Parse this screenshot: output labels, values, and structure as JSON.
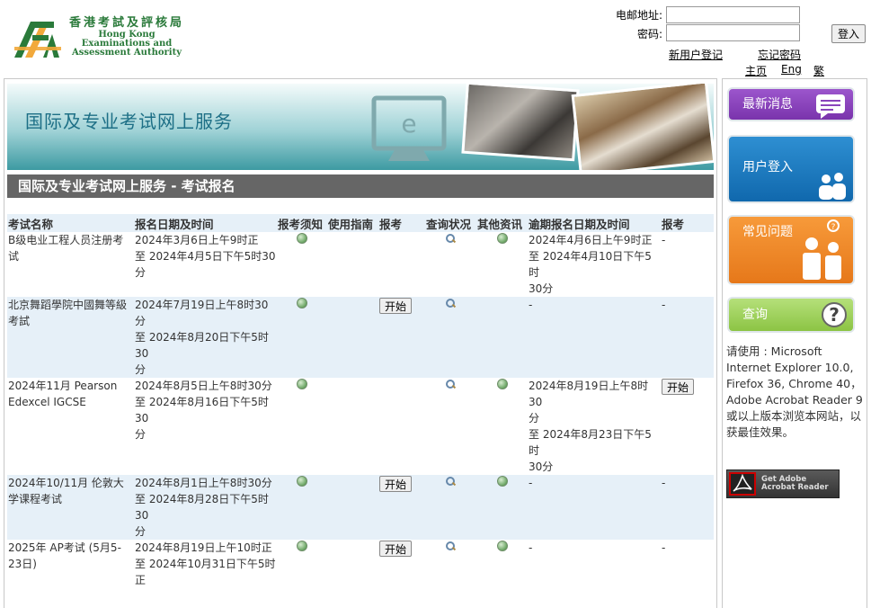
{
  "header": {
    "logo_cn": "香港考試及評核局",
    "logo_en_lines": [
      "Hong Kong",
      "Examinations and",
      "Assessment Authority"
    ],
    "logo_brand_colors": [
      "#2a7a3a",
      "#f2a93b"
    ]
  },
  "login": {
    "email_label": "电邮地址:",
    "password_label": "密码:",
    "email_value": "",
    "password_value": "",
    "login_button": "登入",
    "register_link": "新用户登记",
    "forgot_link": "忘记密码",
    "home_link": "主页",
    "eng_link": "Eng",
    "trad_link": "繁"
  },
  "banner": {
    "title": "国际及专业考试网上服务",
    "screen_letter": "e"
  },
  "section": {
    "title": "国际及专业考试网上服务 - 考试报名"
  },
  "table": {
    "headers": [
      "考试名称",
      "报名日期及时间",
      "报考须知",
      "使用指南",
      "报考",
      "查询状况",
      "其他资讯",
      "逾期报名日期及时间",
      "报考"
    ],
    "rows": [
      {
        "name": "B级电业工程人员注册考试",
        "period": [
          "2024年3月6日上午9时正",
          "至 2024年4月5日下午5时30",
          "分"
        ],
        "notes_icon": "info-icon",
        "guide": "",
        "apply": "",
        "status_icon": "search-icon",
        "other_icon": "info-icon",
        "late_period": [
          "2024年4月6日上午9时正",
          "至 2024年4月10日下午5时",
          "30分"
        ],
        "late_apply": "-"
      },
      {
        "name": "北京舞蹈學院中國舞等級考試",
        "period": [
          "2024年7月19日上午8时30分",
          "至 2024年8月20日下午5时30",
          "分"
        ],
        "notes_icon": "info-icon",
        "guide": "",
        "apply": "开始",
        "status_icon": "search-icon",
        "other_icon": "",
        "late_period": [
          "-"
        ],
        "late_apply": "-"
      },
      {
        "name": "2024年11月 Pearson Edexcel IGCSE",
        "period": [
          "2024年8月5日上午8时30分",
          "至 2024年8月16日下午5时30",
          "分"
        ],
        "notes_icon": "info-icon",
        "guide": "",
        "apply": "",
        "status_icon": "search-icon",
        "other_icon": "info-icon",
        "late_period": [
          "2024年8月19日上午8时30",
          "分",
          "至 2024年8月23日下午5时",
          "30分"
        ],
        "late_apply": "开始"
      },
      {
        "name": "2024年10/11月 伦敦大学课程考试",
        "period": [
          "2024年8月1日上午8时30分",
          "至 2024年8月28日下午5时30",
          "分"
        ],
        "notes_icon": "info-icon",
        "guide": "",
        "apply": "开始",
        "status_icon": "search-icon",
        "other_icon": "info-icon",
        "late_period": [
          "-"
        ],
        "late_apply": "-"
      },
      {
        "name": "2025年 AP考试 (5月5-23日)",
        "period": [
          "2024年8月19日上午10时正",
          "至 2024年10月31日下午5时",
          "正"
        ],
        "notes_icon": "info-icon",
        "guide": "",
        "apply": "开始",
        "status_icon": "search-icon",
        "other_icon": "info-icon",
        "late_period": [
          "-"
        ],
        "late_apply": "-"
      }
    ]
  },
  "sidebar": {
    "news": "最新消息",
    "user_login": "用户登入",
    "faq": "常见问题",
    "query": "查询",
    "note": "请使用 : Microsoft Internet Explorer 10.0, Firefox 36, Chrome 40，Adobe Acrobat Reader 9或以上版本浏览本网站，以获最佳效果。",
    "acrobat_line1": "Get Adobe",
    "acrobat_line2": "Acrobat Reader",
    "colors": {
      "news": "#8a44bc",
      "login": "#1a7bc0",
      "faq": "#ef8a2a",
      "query": "#9fd25a"
    }
  },
  "theme": {
    "section_bar": "#666666",
    "table_alt_row": "#e6f0f8",
    "banner_title": "#1d6f86"
  }
}
